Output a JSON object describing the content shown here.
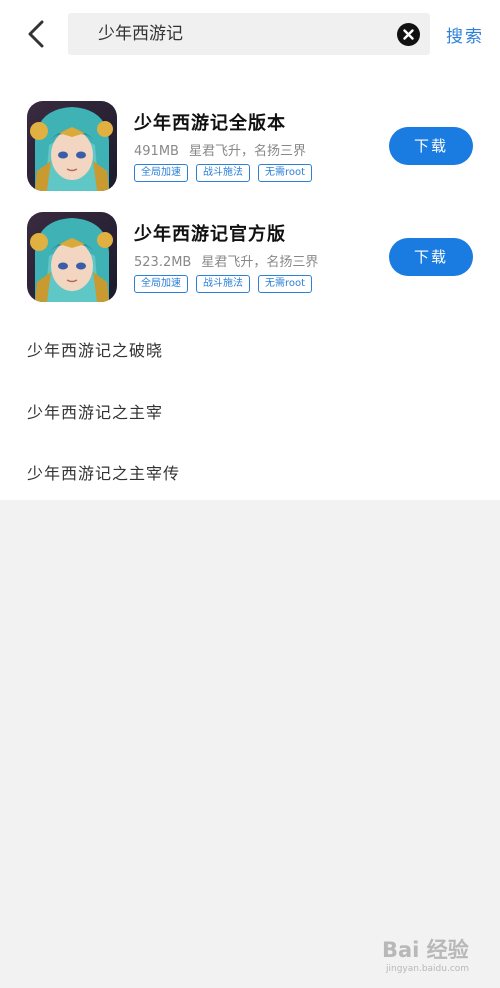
{
  "header": {
    "back_icon": "chevron-left-icon",
    "search_value": "少年西游记",
    "clear_icon": "clear-circle-icon",
    "search_button": "搜索"
  },
  "apps": [
    {
      "name": "少年西游记全版本",
      "size": "491MB",
      "desc": "星君飞升，名扬三界",
      "tags": [
        "全局加速",
        "战斗施法",
        "无需root"
      ],
      "download": "下载"
    },
    {
      "name": "少年西游记官方版",
      "size": "523.2MB",
      "desc": "星君飞升，名扬三界",
      "tags": [
        "全局加速",
        "战斗施法",
        "无需root"
      ],
      "download": "下载"
    }
  ],
  "suggestions": [
    "少年西游记之破晓",
    "少年西游记之主宰",
    "少年西游记之主宰传"
  ],
  "watermark": {
    "main": "Bai 经验",
    "sub": "jingyan.baidu.com"
  },
  "colors": {
    "accent": "#1a7be0",
    "link": "#2c80d8",
    "page_bg": "#f2f2f2"
  }
}
